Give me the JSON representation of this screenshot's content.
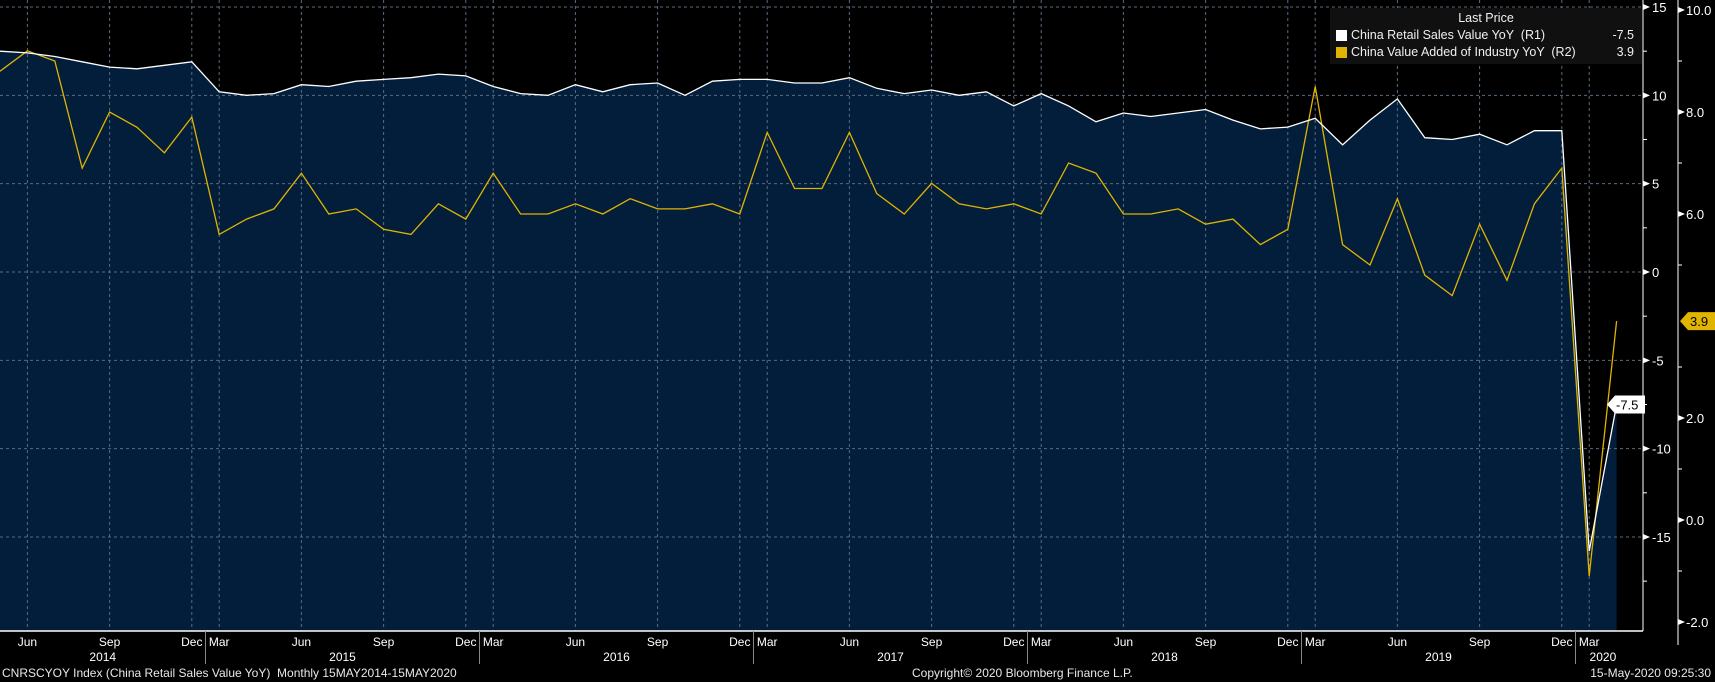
{
  "chart_data": {
    "type": "line",
    "title": "",
    "legend": {
      "header": "Last Price",
      "placement": "top-right",
      "entries": [
        {
          "label": "China Retail Sales Value YoY  (R1)",
          "value": "-7.5",
          "color": "#ffffff"
        },
        {
          "label": "China Value Added of Industry YoY  (R2)",
          "value": "3.9",
          "color": "#e0b400"
        }
      ]
    },
    "x": [
      "May 2014",
      "Jun 2014",
      "Jul 2014",
      "Aug 2014",
      "Sep 2014",
      "Oct 2014",
      "Nov 2014",
      "Dec 2014",
      "Mar 2015",
      "Apr 2015",
      "May 2015",
      "Jun 2015",
      "Jul 2015",
      "Aug 2015",
      "Sep 2015",
      "Oct 2015",
      "Nov 2015",
      "Dec 2015",
      "Mar 2016",
      "Apr 2016",
      "May 2016",
      "Jun 2016",
      "Jul 2016",
      "Aug 2016",
      "Sep 2016",
      "Oct 2016",
      "Nov 2016",
      "Dec 2016",
      "Mar 2017",
      "Apr 2017",
      "May 2017",
      "Jun 2017",
      "Jul 2017",
      "Aug 2017",
      "Sep 2017",
      "Oct 2017",
      "Nov 2017",
      "Dec 2017",
      "Mar 2018",
      "Apr 2018",
      "May 2018",
      "Jun 2018",
      "Jul 2018",
      "Aug 2018",
      "Sep 2018",
      "Oct 2018",
      "Nov 2018",
      "Dec 2018",
      "Mar 2019",
      "Apr 2019",
      "May 2019",
      "Jun 2019",
      "Jul 2019",
      "Aug 2019",
      "Sep 2019",
      "Oct 2019",
      "Nov 2019",
      "Dec 2019",
      "Mar 2020",
      "Apr 2020"
    ],
    "series": [
      {
        "name": "China Retail Sales Value YoY",
        "axis": "R1",
        "color": "#ffffff",
        "fill": "#031e3b",
        "values": [
          12.5,
          12.4,
          12.2,
          11.9,
          11.6,
          11.5,
          11.7,
          11.9,
          10.2,
          10.0,
          10.1,
          10.6,
          10.5,
          10.8,
          10.9,
          11.0,
          11.2,
          11.1,
          10.5,
          10.1,
          10.0,
          10.6,
          10.2,
          10.6,
          10.7,
          10.0,
          10.8,
          10.9,
          10.9,
          10.7,
          10.7,
          11.0,
          10.4,
          10.1,
          10.3,
          10.0,
          10.2,
          9.4,
          10.1,
          9.4,
          8.5,
          9.0,
          8.8,
          9.0,
          9.2,
          8.6,
          8.1,
          8.2,
          8.7,
          7.2,
          8.6,
          9.8,
          7.6,
          7.5,
          7.8,
          7.2,
          8.0,
          8.0,
          -15.8,
          -7.5
        ]
      },
      {
        "name": "China Value Added of Industry YoY",
        "axis": "R2",
        "color": "#e0b400",
        "values": [
          8.8,
          9.2,
          9.0,
          6.9,
          8.0,
          7.7,
          7.2,
          7.9,
          5.6,
          5.9,
          6.1,
          6.8,
          6.0,
          6.1,
          5.7,
          5.6,
          6.2,
          5.9,
          6.8,
          6.0,
          6.0,
          6.2,
          6.0,
          6.3,
          6.1,
          6.1,
          6.2,
          6.0,
          7.6,
          6.5,
          6.5,
          7.6,
          6.4,
          6.0,
          6.6,
          6.2,
          6.1,
          6.2,
          6.0,
          7.0,
          6.8,
          6.0,
          6.0,
          6.1,
          5.8,
          5.9,
          5.4,
          5.7,
          8.5,
          5.4,
          5.0,
          6.3,
          4.8,
          4.4,
          5.8,
          4.7,
          6.2,
          6.9,
          -1.1,
          3.9
        ]
      }
    ],
    "r1_axis": {
      "ylim": [
        -17.5,
        15
      ],
      "ticks": [
        "15",
        "10",
        "5",
        "0",
        "-5",
        "-10",
        "-15"
      ]
    },
    "r2_axis": {
      "ylim": [
        -2.0,
        10.0
      ],
      "ticks": [
        "10.0",
        "8.0",
        "6.0",
        "2.0",
        "0.0",
        "-2.0"
      ]
    },
    "last_value_tags": {
      "r1": "-7.5",
      "r2": "3.9"
    },
    "month_ticks": [
      {
        "label": "Jun",
        "i": 1
      },
      {
        "label": "Sep",
        "i": 4
      },
      {
        "label": "Dec",
        "i": 7
      },
      {
        "label": "Mar",
        "i": 8
      },
      {
        "label": "Jun",
        "i": 11
      },
      {
        "label": "Sep",
        "i": 14
      },
      {
        "label": "Dec",
        "i": 17
      },
      {
        "label": "Mar",
        "i": 18
      },
      {
        "label": "Jun",
        "i": 21
      },
      {
        "label": "Sep",
        "i": 24
      },
      {
        "label": "Dec",
        "i": 27
      },
      {
        "label": "Mar",
        "i": 28
      },
      {
        "label": "Jun",
        "i": 31
      },
      {
        "label": "Sep",
        "i": 34
      },
      {
        "label": "Dec",
        "i": 37
      },
      {
        "label": "Mar",
        "i": 38
      },
      {
        "label": "Jun",
        "i": 41
      },
      {
        "label": "Sep",
        "i": 44
      },
      {
        "label": "Dec",
        "i": 47
      },
      {
        "label": "Mar",
        "i": 48
      },
      {
        "label": "Jun",
        "i": 51
      },
      {
        "label": "Sep",
        "i": 54
      },
      {
        "label": "Dec",
        "i": 57
      },
      {
        "label": "Mar",
        "i": 58
      }
    ],
    "years": [
      "2014",
      "2015",
      "2016",
      "2017",
      "2018",
      "2019",
      "2020"
    ],
    "grid": true
  },
  "footer": {
    "left": "CNRSCYOY Index (China Retail Sales Value YoY)  Monthly 15MAY2014-15MAY2020",
    "center": "Copyright© 2020 Bloomberg Finance L.P.",
    "right": "15-May-2020 09:25:30"
  }
}
